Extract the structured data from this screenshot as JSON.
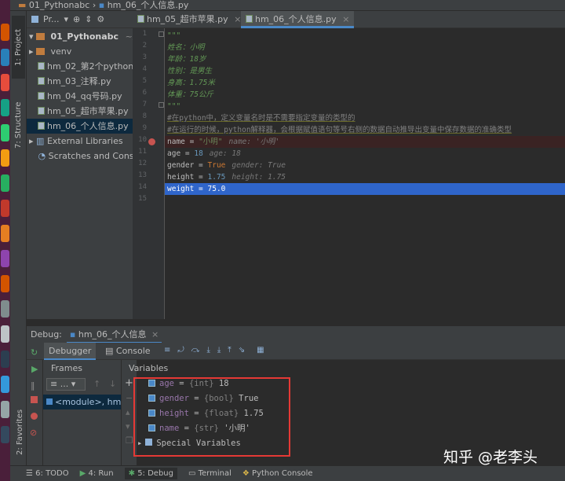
{
  "title_bar": {
    "project": "01_Pythonabc",
    "file": "hm_06_个人信息.py"
  },
  "left_strip": {
    "project_tab": "1: Project",
    "structure_tab": "7: Structure",
    "favorites_tab": "2: Favorites"
  },
  "project_toolbar": {
    "selector": "Pr..."
  },
  "project_tree": {
    "root": {
      "name": "01_Pythonabc",
      "path": "~/Des"
    },
    "items": [
      {
        "label": "venv",
        "kind": "folder"
      },
      {
        "label": "hm_02_第2个python",
        "kind": "file"
      },
      {
        "label": "hm_03_注释.py",
        "kind": "file"
      },
      {
        "label": "hm_04_qq号码.py",
        "kind": "file"
      },
      {
        "label": "hm_05_超市苹果.py",
        "kind": "file"
      },
      {
        "label": "hm_06_个人信息.py",
        "kind": "file"
      }
    ],
    "external": "External Libraries",
    "scratches": "Scratches and Cons"
  },
  "editor_tabs": [
    {
      "label": "hm_05_超市苹果.py",
      "active": false
    },
    {
      "label": "hm_06_个人信息.py",
      "active": true
    }
  ],
  "line_numbers": [
    "1",
    "2",
    "3",
    "4",
    "5",
    "6",
    "7",
    "8",
    "9",
    "10",
    "11",
    "12",
    "13",
    "14",
    "15"
  ],
  "code": {
    "l1": "\"\"\"",
    "l2": "姓名：小明",
    "l3": "年龄：18岁",
    "l4": "性别：是男生",
    "l5": "身高：1.75米",
    "l6": "体重：75公斤",
    "l7": "\"\"\"",
    "l8": "#在python中，定义变量名时是不需要指定变量的类型的",
    "l9": "#在运行的时候，python解释器，会根据赋值语句等号右侧的数据自动推导出变量中保存数据的准确类型",
    "l10": {
      "name": "name",
      "op": " = ",
      "value": "\"小明\"",
      "hint": "name: '小明'"
    },
    "l11": {
      "name": "age",
      "op": " = ",
      "value": "18",
      "hint": "age: 18"
    },
    "l12": {
      "name": "gender",
      "op": " = ",
      "value": "True",
      "hint": "gender: True"
    },
    "l13": {
      "name": "height",
      "op": " = ",
      "value": "1.75",
      "hint": "height: 1.75"
    },
    "l14": {
      "name": "weight",
      "op": " = ",
      "value": "75.0"
    }
  },
  "debug": {
    "label": "Debug:",
    "config": "hm_06_个人信息",
    "tab_debugger": "Debugger",
    "tab_console": "Console",
    "frames_label": "Frames",
    "frames_dropdown": "...",
    "frame_item": "<module>, hm",
    "variables_label": "Variables",
    "variables": [
      {
        "name": "age",
        "type": "{int}",
        "value": "18"
      },
      {
        "name": "gender",
        "type": "{bool}",
        "value": "True"
      },
      {
        "name": "height",
        "type": "{float}",
        "value": "1.75"
      },
      {
        "name": "name",
        "type": "{str}",
        "value": "'小明'"
      }
    ],
    "special": "Special Variables"
  },
  "status_bar": {
    "todo": "6: TODO",
    "run": "4: Run",
    "debug": "5: Debug",
    "terminal": "Terminal",
    "console": "Python Console"
  },
  "watermark": "知乎 @老李头",
  "colors": {
    "accent": "#4a88c7",
    "highlight_box": "#e53935",
    "breakpoint": "#c75450"
  }
}
